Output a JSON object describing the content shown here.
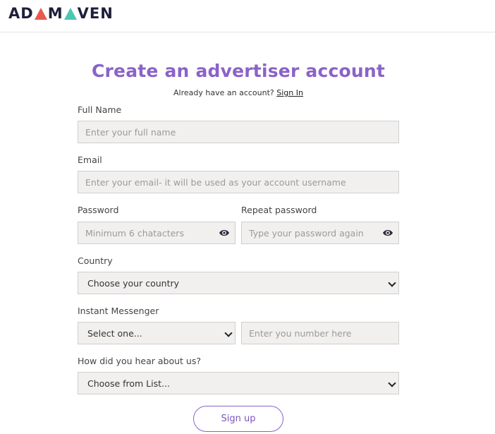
{
  "header": {
    "logo": "ADMAVEN"
  },
  "title": "Create an advertiser account",
  "signin": {
    "prompt": "Already have an account?",
    "link": "Sign In"
  },
  "fields": {
    "full_name": {
      "label": "Full Name",
      "placeholder": "Enter your full name"
    },
    "email": {
      "label": "Email",
      "placeholder": "Enter your email- it will be used as your account username"
    },
    "password": {
      "label": "Password",
      "placeholder": "Minimum 6 chatacters"
    },
    "repeat_password": {
      "label": "Repeat password",
      "placeholder": "Type your password again"
    },
    "country": {
      "label": "Country",
      "value": "Choose your country"
    },
    "messenger": {
      "label": "Instant Messenger",
      "value": "Select one...",
      "number_placeholder": "Enter you number here"
    },
    "heard": {
      "label": "How did you hear about us?",
      "value": "Choose from List..."
    }
  },
  "submit_label": "Sign up",
  "colors": {
    "accent": "#8a63c8",
    "field_bg": "#f2f0ef",
    "logo_red": "#e85a4f",
    "logo_teal": "#4cc7b4"
  }
}
